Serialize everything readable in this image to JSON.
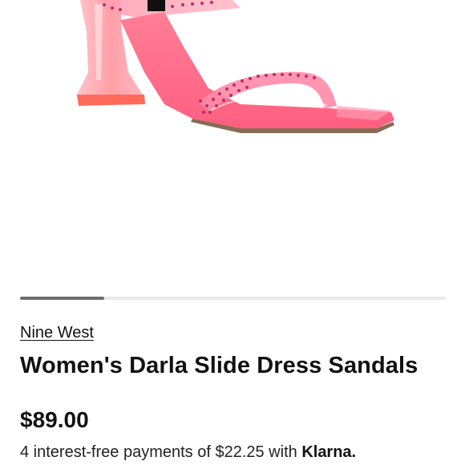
{
  "product": {
    "brand": "Nine West",
    "title": "Women's Darla Slide Dress Sandals",
    "price": "$89.00",
    "image_icon": "pink-heeled-sandal-image"
  },
  "carousel": {
    "current_index": 1,
    "progress": 0.2
  },
  "installments": {
    "prefix": "4 interest-free payments of ",
    "amount": "$22.25",
    "middle": " with ",
    "provider": "Klarna."
  },
  "colors": {
    "accent": "#111111",
    "sandal_pink": "#ff6b8a",
    "heel_pink": "#ff7f86"
  }
}
